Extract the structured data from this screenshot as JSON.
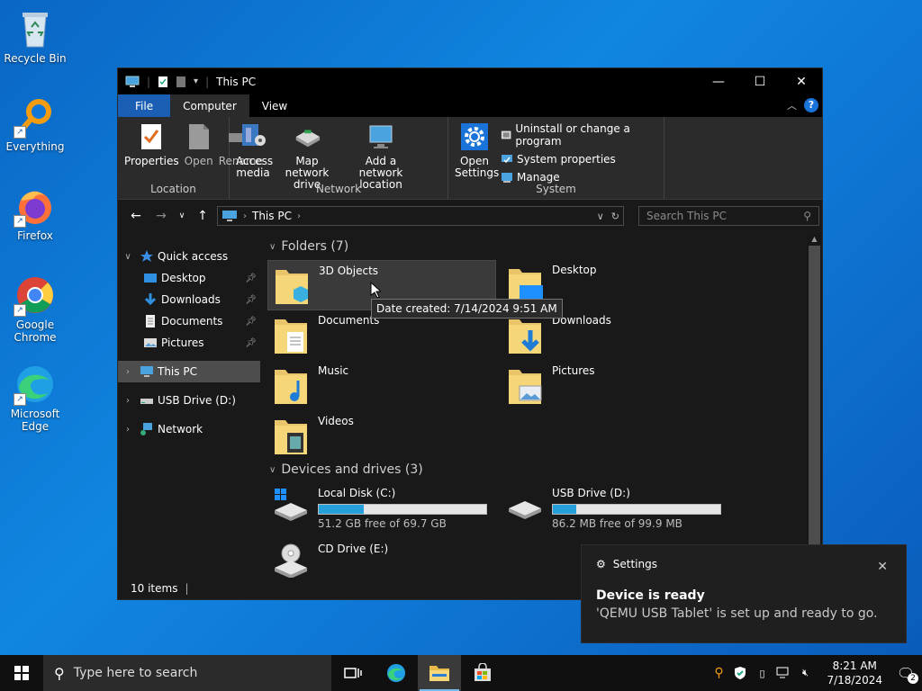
{
  "desktop": {
    "icons": [
      {
        "label": "Recycle Bin"
      },
      {
        "label": "Everything"
      },
      {
        "label": "Firefox"
      },
      {
        "label": "Google Chrome"
      },
      {
        "label": "Microsoft Edge"
      }
    ]
  },
  "window": {
    "title": "This PC",
    "tabs": {
      "file": "File",
      "computer": "Computer",
      "view": "View"
    },
    "ribbon": {
      "location": {
        "label": "Location",
        "properties": "Properties",
        "open": "Open",
        "rename": "Rename"
      },
      "network": {
        "label": "Network",
        "access_media": "Access media",
        "map_drive": "Map network drive",
        "add_location": "Add a network location"
      },
      "system": {
        "label": "System",
        "open_settings": "Open Settings",
        "uninstall": "Uninstall or change a program",
        "system_properties": "System properties",
        "manage": "Manage"
      }
    },
    "address": {
      "path": "This PC",
      "search_placeholder": "Search This PC"
    },
    "nav": {
      "quick_access": "Quick access",
      "desktop": "Desktop",
      "downloads": "Downloads",
      "documents": "Documents",
      "pictures": "Pictures",
      "this_pc": "This PC",
      "usb_drive": "USB Drive (D:)",
      "network": "Network"
    },
    "folders_header": "Folders (7)",
    "folders": [
      {
        "name": "3D Objects"
      },
      {
        "name": "Desktop"
      },
      {
        "name": "Documents"
      },
      {
        "name": "Downloads"
      },
      {
        "name": "Music"
      },
      {
        "name": "Pictures"
      },
      {
        "name": "Videos"
      }
    ],
    "devices_header": "Devices and drives (3)",
    "drives": [
      {
        "name": "Local Disk (C:)",
        "free": "51.2 GB free of 69.7 GB",
        "used_fraction": 0.27
      },
      {
        "name": "USB Drive (D:)",
        "free": "86.2 MB free of 99.9 MB",
        "used_fraction": 0.14
      },
      {
        "name": "CD Drive (E:)"
      }
    ],
    "tooltip": "Date created: 7/14/2024 9:51 AM",
    "status": "10 items"
  },
  "toast": {
    "app": "Settings",
    "title": "Device is ready",
    "body": "'QEMU USB Tablet' is set up and ready to go."
  },
  "taskbar": {
    "search_placeholder": "Type here to search",
    "time": "8:21 AM",
    "date": "7/18/2024",
    "notifications": "2"
  }
}
